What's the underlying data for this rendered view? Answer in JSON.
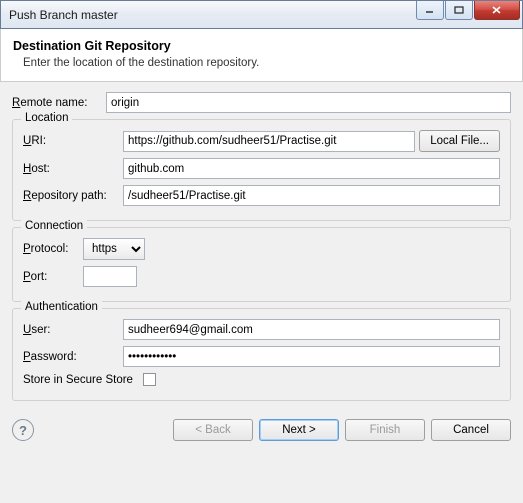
{
  "titlebar": {
    "title": "Push Branch master"
  },
  "header": {
    "heading": "Destination Git Repository",
    "subtext": "Enter the location of the destination repository."
  },
  "remote": {
    "label": "Remote name:",
    "value": "origin"
  },
  "location": {
    "group": "Location",
    "uri_label": "URI:",
    "uri": "https://github.com/sudheer51/Practise.git",
    "local_file_btn": "Local File...",
    "host_label": "Host:",
    "host": "github.com",
    "repo_label": "Repository path:",
    "repo": "/sudheer51/Practise.git"
  },
  "connection": {
    "group": "Connection",
    "protocol_label": "Protocol:",
    "protocol": "https",
    "port_label": "Port:",
    "port": ""
  },
  "auth": {
    "group": "Authentication",
    "user_label": "User:",
    "user": "sudheer694@gmail.com",
    "password_label": "Password:",
    "password": "••••••••••••",
    "store_label": "Store in Secure Store"
  },
  "buttons": {
    "back": "< Back",
    "next": "Next >",
    "finish": "Finish",
    "cancel": "Cancel"
  }
}
